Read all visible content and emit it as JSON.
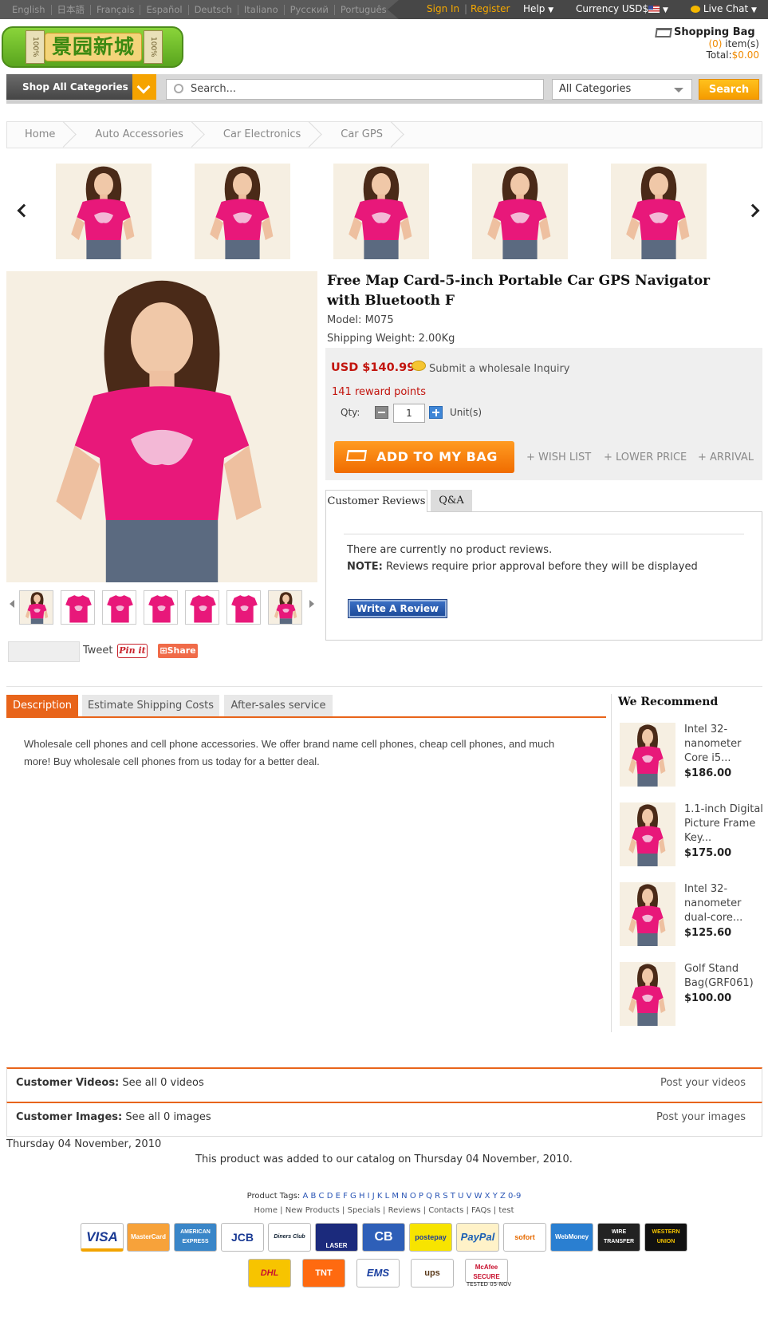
{
  "topbar": {
    "languages": [
      "English",
      "日本語",
      "Français",
      "Español",
      "Deutsch",
      "Italiano",
      "Русский",
      "Português"
    ],
    "sign_in": "Sign In",
    "separator": "|",
    "register": "Register",
    "help": "Help",
    "currency": "Currency USD$",
    "live_chat": "Live Chat"
  },
  "header": {
    "logo_text": "景园新城",
    "logo_seal": "100%",
    "bag_title": "Shopping Bag",
    "bag_count": "(0)",
    "bag_items_label": "item(s)",
    "bag_total_label": "Total:",
    "bag_total_value": "$0.00"
  },
  "search": {
    "categories_button": "Shop All Categories",
    "placeholder": "Search...",
    "category_select": "All Categories",
    "button": "Search"
  },
  "breadcrumb": [
    "Home",
    "Auto Accessories",
    "Car Electronics",
    "Car GPS"
  ],
  "product": {
    "title": "Free Map Card-5-inch Portable Car GPS Navigator with Bluetooth F",
    "model_label": "Model:",
    "model": "M075",
    "weight_label": "Shipping Weight:",
    "weight": "2.00Kg",
    "price": "USD $140.99",
    "inquiry": "Submit a wholesale Inquiry",
    "reward": "141 reward points",
    "qty_label": "Qty:",
    "qty_value": "1",
    "unit_label": "Unit(s)",
    "add_to_bag": "ADD TO MY BAG",
    "wish_list": "+ WISH LIST",
    "lower_price": "+ LOWER PRICE",
    "arrival": "+ ARRIVAL",
    "tweet": "Tweet",
    "pinit": "Pin it",
    "share": "Share"
  },
  "reviews": {
    "tab_reviews": "Customer Reviews",
    "tab_qa": "Q&A",
    "empty_text": "There are currently no product reviews.",
    "note_label": "NOTE:",
    "note_text": " Reviews require prior approval before they will be displayed",
    "write_button": "Write A Review"
  },
  "description": {
    "tabs": [
      "Description",
      "Estimate Shipping Costs",
      "After-sales service"
    ],
    "text": "Wholesale cell phones and cell phone accessories. We offer brand name cell phones, cheap cell phones, and much more! Buy wholesale cell phones from us today for a better deal."
  },
  "recommend": {
    "heading": "We Recommend",
    "items": [
      {
        "name": "Intel 32-nanometer Core i5...",
        "price": "$186.00"
      },
      {
        "name": "1.1-inch Digital Picture Frame Key...",
        "price": "$175.00"
      },
      {
        "name": "Intel 32-nanometer dual-core...",
        "price": "$125.60"
      },
      {
        "name": "Golf Stand Bag(GRF061)",
        "price": "$100.00"
      }
    ]
  },
  "media": {
    "videos_label": "Customer Videos:",
    "videos_link": " See all 0 videos",
    "videos_post": "Post your videos",
    "images_label": "Customer Images:",
    "images_link": " See all 0 images",
    "images_post": "Post your images"
  },
  "catalog": {
    "date": "Thursday 04 November, 2010",
    "added": "This product was added to our catalog on Thursday 04 November, 2010."
  },
  "footer": {
    "tags_label": "Product Tags:",
    "tags_letters": "A B C D E F G H I J K L M N O P Q R S T U V W X Y Z 0-9",
    "links": "Home | New Products | Specials | Reviews | Contacts | FAQs | test",
    "payments": [
      "VISA",
      "MasterCard",
      "AMERICAN EXPRESS",
      "JCB",
      "Diners Club",
      "LASER",
      "CB",
      "postepay",
      "PayPal",
      "sofort",
      "WebMoney",
      "WIRE TRANSFER",
      "WESTERN UNION"
    ],
    "shipping": [
      "DHL",
      "TNT",
      "EMS",
      "ups",
      "McAfee SECURE"
    ],
    "tested": "TESTED 05-NOV"
  },
  "colors": {
    "accent": "#e8641a",
    "price": "#c2140d",
    "orange_button": "#f5a300"
  }
}
